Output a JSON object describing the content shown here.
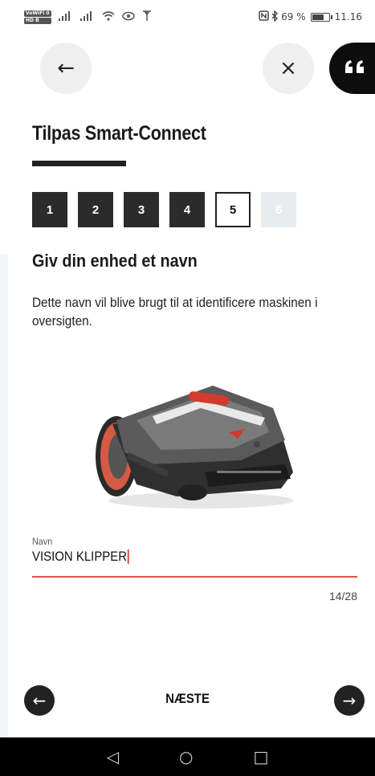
{
  "status_bar": {
    "badges": [
      "VoWiFi 0",
      "HD B"
    ],
    "icons": [
      "signal-icon",
      "signal-icon",
      "wifi-icon",
      "eye-icon",
      "antenna-icon",
      "nfc-icon",
      "bluetooth-icon",
      "battery-icon"
    ],
    "battery": "69 %",
    "time": "11.16"
  },
  "header": {
    "back_icon": "←",
    "close_icon": "×",
    "chat_icon": "❝"
  },
  "title": "Tilpas Smart-Connect",
  "steps": [
    {
      "label": "1",
      "state": "done"
    },
    {
      "label": "2",
      "state": "done"
    },
    {
      "label": "3",
      "state": "done"
    },
    {
      "label": "4",
      "state": "done"
    },
    {
      "label": "5",
      "state": "current"
    },
    {
      "label": "6",
      "state": "future"
    }
  ],
  "section": {
    "heading": "Giv din enhed et navn",
    "description": "Dette navn vil blive brugt til at identificere maskinen i oversigten."
  },
  "name_field": {
    "label": "Navn",
    "value": "VISION KLIPPER",
    "counter": "14/28"
  },
  "footer": {
    "prev_icon": "←",
    "next_label": "NÆSTE",
    "next_icon": "→"
  },
  "system_nav": {
    "back": "◁",
    "home": "○",
    "recents": "□"
  },
  "colors": {
    "accent": "#d33a2c",
    "dark": "#222222",
    "step_future": "#e9ecee"
  }
}
